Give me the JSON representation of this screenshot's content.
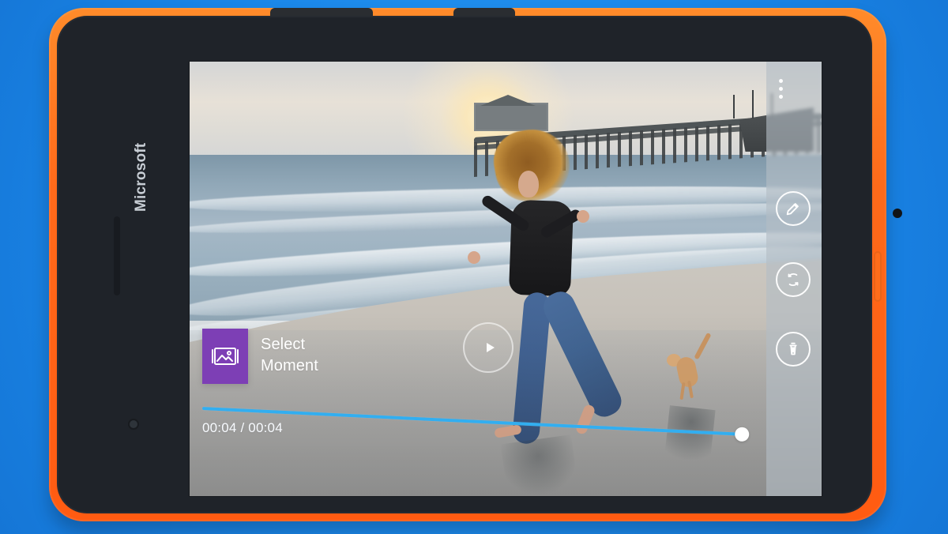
{
  "device": {
    "brand": "Microsoft"
  },
  "video_editor": {
    "select_moment": {
      "line1": "Select",
      "line2": "Moment"
    },
    "timecode": "00:04 / 00:04",
    "progress": 1.0,
    "icons": {
      "more": "more-vertical-icon",
      "moment": "photo-icon",
      "play": "play-icon",
      "edit": "edit-icon",
      "rotate": "rotate-icon",
      "delete": "trash-icon"
    },
    "colors": {
      "accent": "#32aef0",
      "moment_tile": "#7d3fb5",
      "phone_body": "#ff6a1a",
      "background": "#1e8fec"
    }
  }
}
